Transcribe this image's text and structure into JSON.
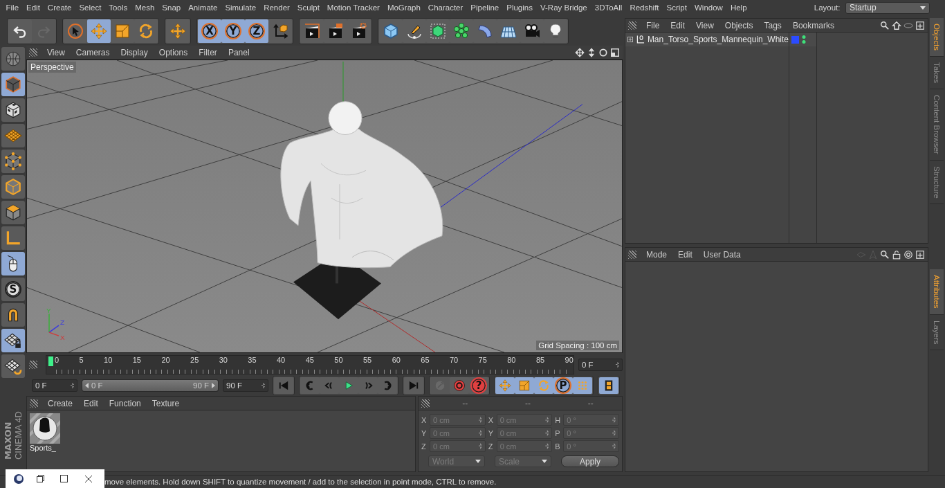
{
  "menu_bar": {
    "items": [
      "File",
      "Edit",
      "Create",
      "Select",
      "Tools",
      "Mesh",
      "Snap",
      "Animate",
      "Simulate",
      "Render",
      "Sculpt",
      "Motion Tracker",
      "MoGraph",
      "Character",
      "Pipeline",
      "Plugins",
      "V-Ray Bridge",
      "3DToAll",
      "Redshift",
      "Script",
      "Window",
      "Help"
    ],
    "layout_label": "Layout:",
    "layout_value": "Startup"
  },
  "toolbar": [
    [
      {
        "kind": "undo",
        "selected": false,
        "disabled": false
      },
      {
        "kind": "redo",
        "selected": false,
        "disabled": true
      }
    ],
    [
      {
        "kind": "select",
        "selected": false,
        "disabled": false
      },
      {
        "kind": "move",
        "selected": true,
        "disabled": false
      },
      {
        "kind": "scale",
        "selected": false,
        "disabled": false
      },
      {
        "kind": "rotate",
        "selected": false,
        "disabled": false
      }
    ],
    [
      {
        "kind": "move",
        "selected": false,
        "disabled": false
      }
    ],
    [
      {
        "kind": "axis",
        "label": "X",
        "selected": true,
        "disabled": false
      },
      {
        "kind": "axis",
        "label": "Y",
        "selected": true,
        "disabled": false
      },
      {
        "kind": "axis",
        "label": "Z",
        "selected": true,
        "disabled": false
      },
      {
        "kind": "coordinates",
        "selected": false,
        "disabled": false
      }
    ],
    [
      {
        "kind": "render-view",
        "selected": false,
        "disabled": false
      },
      {
        "kind": "render-picture",
        "selected": false,
        "disabled": false
      },
      {
        "kind": "render-settings",
        "selected": false,
        "disabled": false
      }
    ],
    [
      {
        "kind": "cube",
        "selected": false,
        "disabled": false
      },
      {
        "kind": "pen",
        "selected": false,
        "disabled": false
      },
      {
        "kind": "subdivision",
        "selected": false,
        "disabled": false
      },
      {
        "kind": "cloner",
        "selected": false,
        "disabled": false
      },
      {
        "kind": "deformer",
        "selected": false,
        "disabled": false
      },
      {
        "kind": "floor",
        "selected": false,
        "disabled": false
      },
      {
        "kind": "camera",
        "selected": false,
        "disabled": false
      },
      {
        "kind": "light",
        "selected": false,
        "disabled": false
      }
    ]
  ],
  "left_tools": [
    {
      "kind": "view",
      "selected": false
    },
    {
      "kind": "model",
      "selected": true
    },
    {
      "kind": "texture",
      "selected": false
    },
    {
      "kind": "workplane",
      "selected": false
    },
    {
      "kind": "points",
      "selected": false
    },
    {
      "kind": "edges",
      "selected": false
    },
    {
      "kind": "polygons",
      "selected": false
    },
    {
      "kind": "axis-mode",
      "selected": false
    },
    {
      "kind": "tweak",
      "selected": true
    },
    {
      "kind": "snap",
      "label": "S",
      "selected": false
    },
    {
      "kind": "magnet",
      "selected": false
    },
    {
      "kind": "grid-lock",
      "selected": true
    },
    {
      "kind": "grid-rotate",
      "selected": false
    }
  ],
  "logo": {
    "brand": "MAXON",
    "product": "CINEMA 4D"
  },
  "viewport": {
    "menu": [
      "View",
      "Cameras",
      "Display",
      "Options",
      "Filter",
      "Panel"
    ],
    "camera": "Perspective",
    "grid_spacing": "Grid Spacing : 100 cm",
    "gizmo": [
      "Y",
      "Z",
      "X"
    ]
  },
  "timeline": {
    "ticks": [
      "0",
      "5",
      "10",
      "15",
      "20",
      "25",
      "30",
      "35",
      "40",
      "45",
      "50",
      "55",
      "60",
      "65",
      "70",
      "75",
      "80",
      "85",
      "90"
    ],
    "playhead": {
      "level": 0
    },
    "current_frame": "0 F"
  },
  "transport": {
    "start_frame": "0 F",
    "range": {
      "start": "0 F",
      "end": "90 F",
      "level": 1
    },
    "end_frame": "90 F",
    "buttons": [
      [
        {
          "kind": "first-frame",
          "selected": false,
          "disabled": false
        }
      ],
      [
        {
          "kind": "prev-key",
          "selected": false,
          "disabled": false
        },
        {
          "kind": "prev-frame",
          "selected": false,
          "disabled": false
        },
        {
          "kind": "play",
          "selected": false,
          "disabled": false
        },
        {
          "kind": "next-frame",
          "selected": false,
          "disabled": false
        },
        {
          "kind": "next-key",
          "selected": false,
          "disabled": false
        }
      ],
      [
        {
          "kind": "last-frame",
          "selected": false,
          "disabled": false
        }
      ],
      [
        {
          "kind": "record",
          "selected": false,
          "disabled": true
        },
        {
          "kind": "autokey",
          "selected": false,
          "disabled": false
        },
        {
          "kind": "key-help",
          "label": "?",
          "selected": false,
          "disabled": false
        }
      ],
      [
        {
          "kind": "move",
          "selected": true,
          "disabled": false
        },
        {
          "kind": "scale",
          "selected": true,
          "disabled": false
        },
        {
          "kind": "rotate",
          "selected": true,
          "disabled": false
        },
        {
          "kind": "parameter",
          "label": "P",
          "selected": true,
          "disabled": false
        },
        {
          "kind": "point-level",
          "selected": true,
          "disabled": false
        }
      ],
      [
        {
          "kind": "film",
          "selected": true,
          "disabled": false
        }
      ]
    ]
  },
  "material_manager": {
    "menu": [
      "Create",
      "Edit",
      "Function",
      "Texture"
    ],
    "materials": [
      {
        "name": "Sports_"
      }
    ]
  },
  "coordinates": {
    "headers": [
      "--",
      "--",
      "--"
    ],
    "disabled": true,
    "rows": [
      [
        {
          "axis": "X",
          "value": "0 cm"
        },
        {
          "axis": "X",
          "value": "0 cm"
        },
        {
          "axis": "H",
          "value": "0 °"
        }
      ],
      [
        {
          "axis": "Y",
          "value": "0 cm"
        },
        {
          "axis": "Y",
          "value": "0 cm"
        },
        {
          "axis": "P",
          "value": "0 °"
        }
      ],
      [
        {
          "axis": "Z",
          "value": "0 cm"
        },
        {
          "axis": "Z",
          "value": "0 cm"
        },
        {
          "axis": "B",
          "value": "0 °"
        }
      ]
    ],
    "mode": "World",
    "transform": "Scale",
    "apply": "Apply"
  },
  "status_bar": {
    "text": "move elements. Hold down SHIFT to quantize movement / add to the selection in point mode, CTRL to remove."
  },
  "object_manager": {
    "menu": [
      "File",
      "Edit",
      "View",
      "Objects",
      "Tags",
      "Bookmarks"
    ],
    "objects": [
      {
        "name": "Man_Torso_Sports_Mannequin_White",
        "color": "#2b4bff",
        "expanded": false
      }
    ]
  },
  "attribute_manager": {
    "menu": [
      "Mode",
      "Edit",
      "User Data"
    ]
  },
  "side_tabs": {
    "upper": [
      {
        "label": "Objects",
        "selected": true
      },
      {
        "label": "Takes",
        "selected": false
      },
      {
        "label": "Content Browser",
        "selected": false
      },
      {
        "label": "Structure",
        "selected": false
      }
    ],
    "lower": [
      {
        "label": "Attributes",
        "selected": true
      },
      {
        "label": "Layers",
        "selected": false
      }
    ]
  }
}
